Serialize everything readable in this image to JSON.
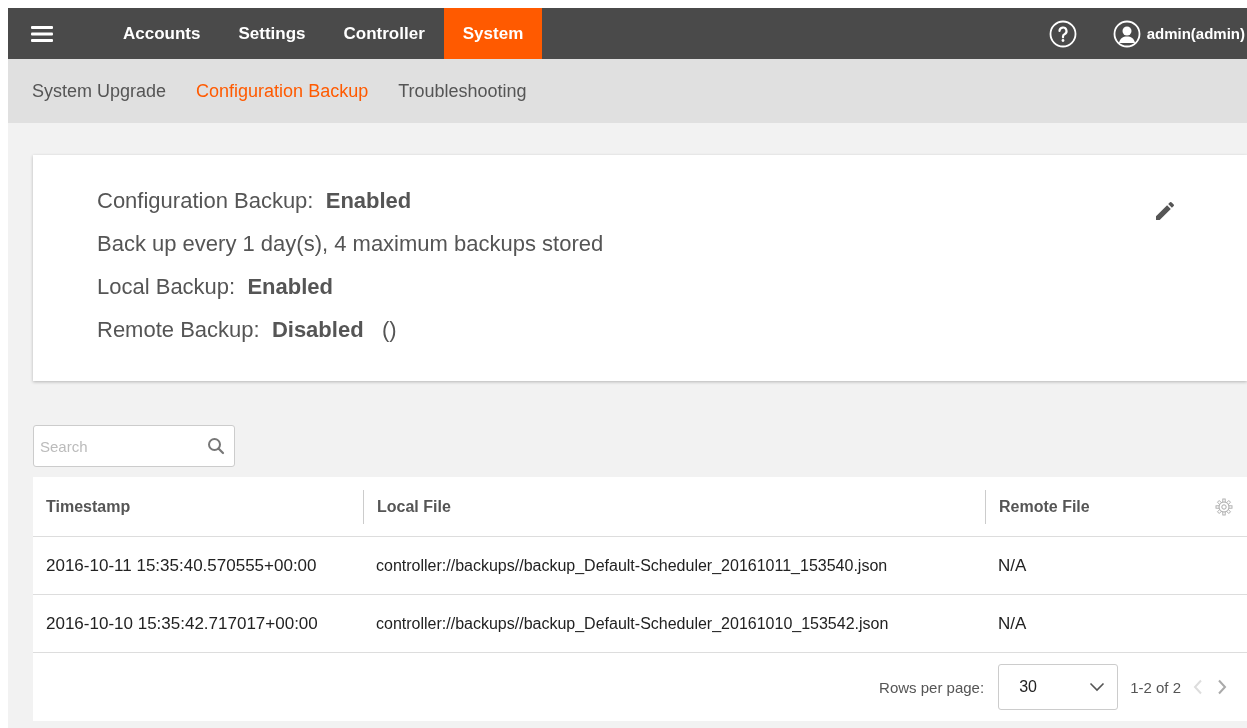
{
  "topbar": {
    "tabs": [
      {
        "label": "Accounts",
        "selected": false
      },
      {
        "label": "Settings",
        "selected": false
      },
      {
        "label": "Controller",
        "selected": false
      },
      {
        "label": "System",
        "selected": true
      }
    ],
    "user": "admin(admin)"
  },
  "subnav": [
    {
      "label": "System Upgrade",
      "selected": false
    },
    {
      "label": "Configuration Backup",
      "selected": true
    },
    {
      "label": "Troubleshooting",
      "selected": false
    }
  ],
  "summary": {
    "lines": [
      "Configuration Backup:  **Enabled**",
      "Back up every 1 day(s), 4 maximum backups stored",
      "Local Backup:  **Enabled**",
      "Remote Backup:  **Disabled**   ()"
    ]
  },
  "search": {
    "placeholder": "Search"
  },
  "table": {
    "columns": [
      "Timestamp",
      "Local File",
      "Remote File"
    ],
    "rows": [
      [
        "2016-10-11 15:35:40.570555+00:00",
        "controller://backups//backup_Default-Scheduler_20161011_153540.json",
        "N/A"
      ],
      [
        "2016-10-10 15:35:42.717017+00:00",
        "controller://backups//backup_Default-Scheduler_20161010_153542.json",
        "N/A"
      ]
    ]
  },
  "pagination": {
    "rows_label": "Rows per page:",
    "rows_value": "30",
    "range": "1-2 of 2",
    "prev_disabled": true,
    "next_disabled": false
  }
}
